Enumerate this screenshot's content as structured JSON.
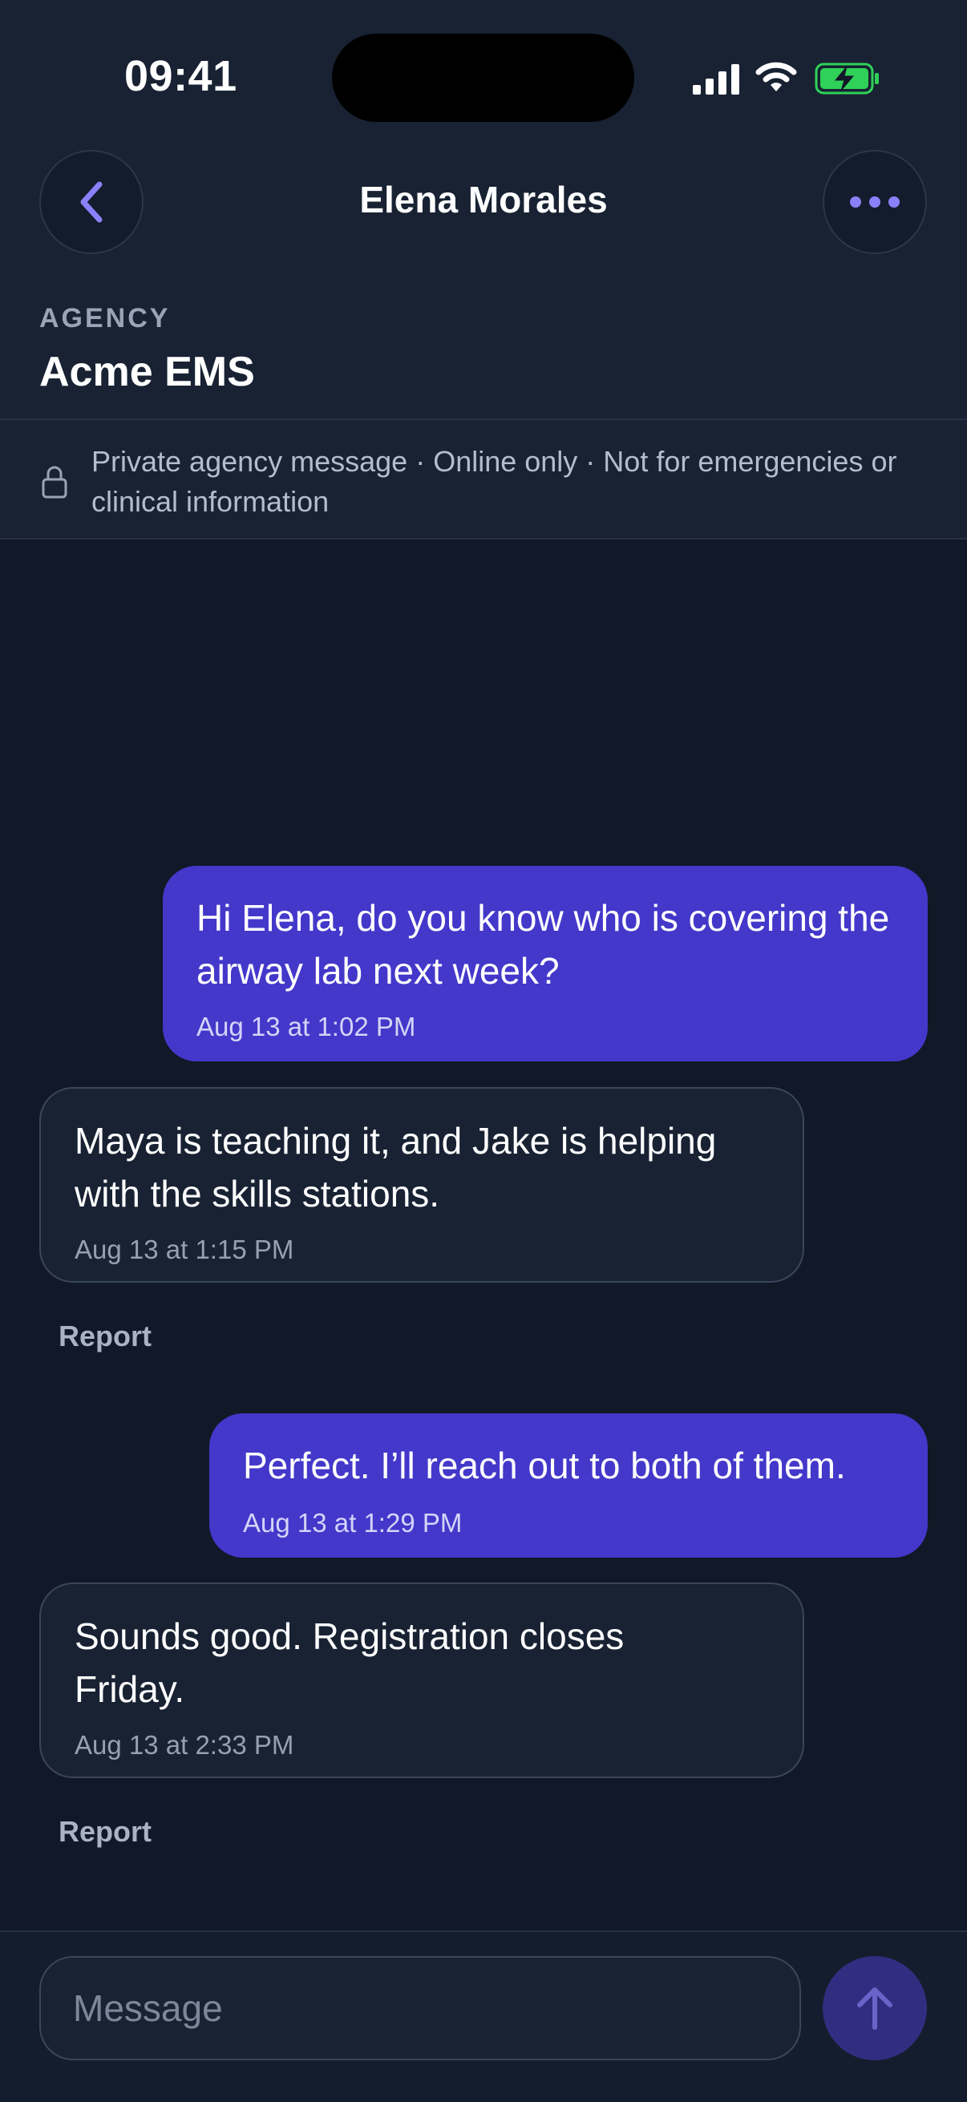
{
  "status_bar": {
    "time": "09:41",
    "icons": [
      "signal-icon",
      "wifi-icon",
      "battery-charging-icon"
    ]
  },
  "header": {
    "contact_name": "Elena Morales",
    "back_icon": "chevron-left-icon",
    "more_icon": "ellipsis-icon"
  },
  "agency": {
    "label": "AGENCY",
    "name": "Acme EMS"
  },
  "notice": {
    "icon": "lock-icon",
    "text": "Private agency message · Online only · Not for emergencies or clinical information"
  },
  "messages": [
    {
      "direction": "outgoing",
      "text": "Hi Elena, do you know who is covering the airway lab next week?",
      "time": "Aug 13 at 1:02 PM"
    },
    {
      "direction": "incoming",
      "text": "Maya is teaching it, and Jake is helping with the skills stations.",
      "time": "Aug 13 at 1:15 PM",
      "action": "Report"
    },
    {
      "direction": "outgoing",
      "text": "Perfect. I’ll reach out to both of them.",
      "time": "Aug 13 at 1:29 PM"
    },
    {
      "direction": "incoming",
      "text": "Sounds good. Registration closes Friday.",
      "time": "Aug 13 at 2:33 PM",
      "action": "Report"
    }
  ],
  "composer": {
    "placeholder": "Message",
    "value": "",
    "send_icon": "arrow-up-icon"
  },
  "colors": {
    "background": "#111827",
    "header_background": "#182233",
    "accent": "#4338ca",
    "accent_icon": "#8b80f9",
    "send_button": "#312e81",
    "battery_charging": "#30d158"
  }
}
